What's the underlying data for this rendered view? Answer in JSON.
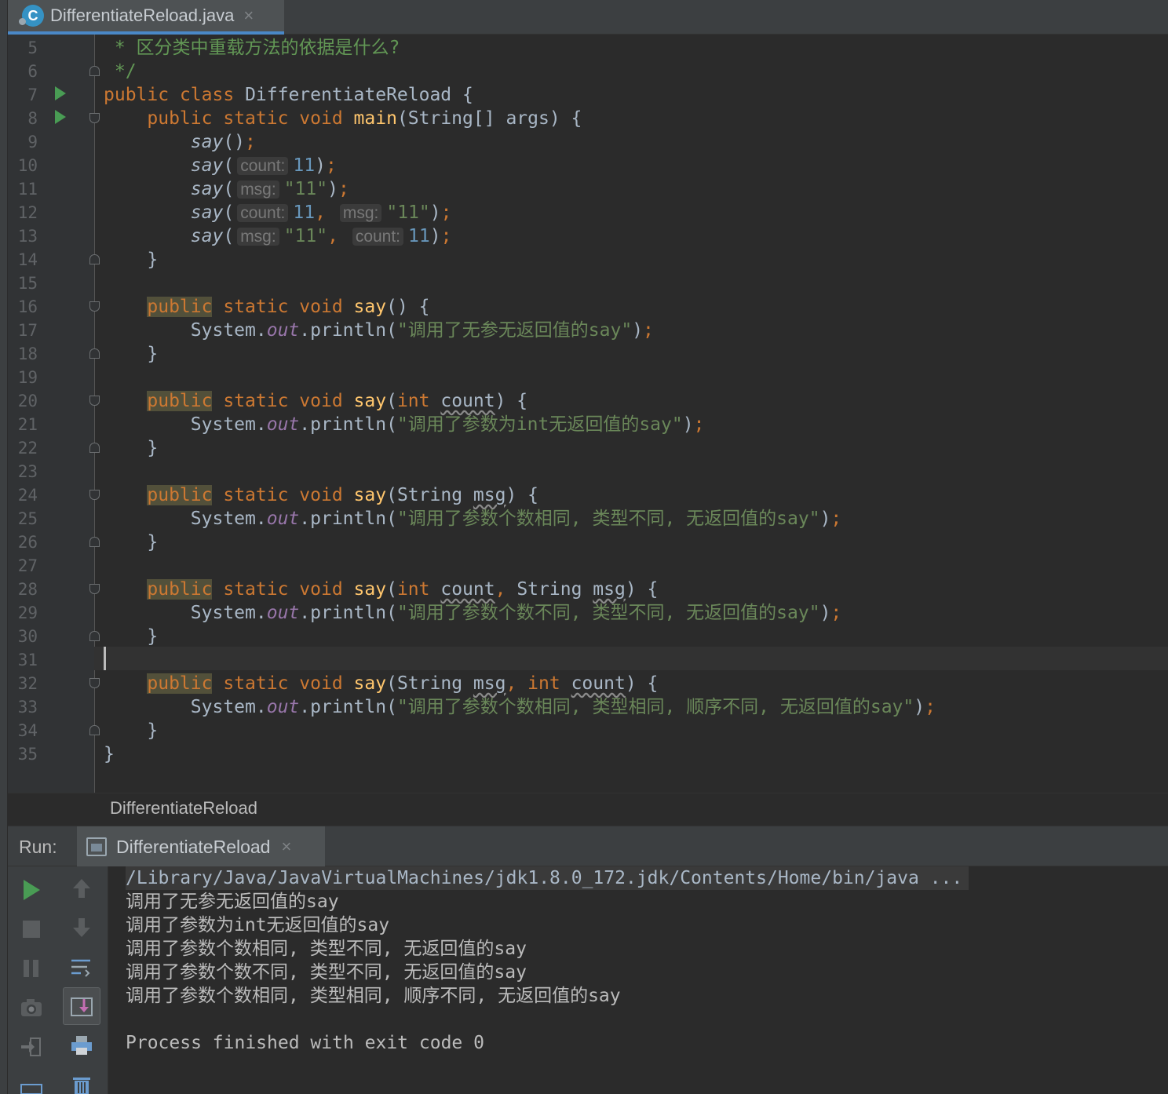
{
  "tab": {
    "title": "DifferentiateReload.java",
    "icon": "java-class-icon",
    "close": "×"
  },
  "editor": {
    "line_numbers": [
      "5",
      "6",
      "7",
      "8",
      "9",
      "10",
      "11",
      "12",
      "13",
      "14",
      "15",
      "16",
      "17",
      "18",
      "19",
      "20",
      "21",
      "22",
      "23",
      "24",
      "25",
      "26",
      "27",
      "28",
      "29",
      "30",
      "31",
      "32",
      "33",
      "34",
      "35"
    ],
    "code": {
      "l5_comment": " * 区分类中重载方法的依据是什么?",
      "l6_comment": " */",
      "kw_public": "public",
      "kw_class": "class",
      "kw_static": "static",
      "kw_void": "void",
      "kw_int": "int",
      "class_name": "DifferentiateReload",
      "main": "main",
      "string_type": "String",
      "args": "args",
      "say": "say",
      "system": "System",
      "out": "out",
      "println": "println",
      "hint_count": "count:",
      "hint_msg": "msg:",
      "num_11": "11",
      "str_11": "\"11\"",
      "param_count": "count",
      "param_msg": "msg",
      "s1": "\"调用了无参无返回值的say\"",
      "s2": "\"调用了参数为int无返回值的say\"",
      "s3": "\"调用了参数个数相同, 类型不同, 无返回值的say\"",
      "s4": "\"调用了参数个数不同, 类型不同, 无返回值的say\"",
      "s5": "\"调用了参数个数相同, 类型相同, 顺序不同, 无返回值的say\""
    }
  },
  "breadcrumb": {
    "text": "DifferentiateReload"
  },
  "run_panel": {
    "label": "Run:",
    "tab_title": "DifferentiateReload",
    "tab_close": "×",
    "toolbar": [
      "rerun-icon",
      "stop-icon",
      "pause-icon",
      "camera-icon",
      "exit-icon",
      "up-arrow-icon",
      "down-arrow-icon",
      "soft-wrap-icon",
      "scroll-to-end-icon",
      "print-icon",
      "trash-icon"
    ],
    "console": {
      "command": "/Library/Java/JavaVirtualMachines/jdk1.8.0_172.jdk/Contents/Home/bin/java ...",
      "lines": [
        "调用了无参无返回值的say",
        "调用了参数为int无返回值的say",
        "调用了参数个数相同, 类型不同, 无返回值的say",
        "调用了参数个数不同, 类型不同, 无返回值的say",
        "调用了参数个数相同, 类型相同, 顺序不同, 无返回值的say"
      ],
      "exit": "Process finished with exit code 0"
    }
  },
  "colors": {
    "keyword": "#cc7832",
    "method": "#ffc66d",
    "string": "#6a8759",
    "number": "#6897bb",
    "field": "#9876aa",
    "comment": "#629755",
    "run_green": "#499c54"
  }
}
